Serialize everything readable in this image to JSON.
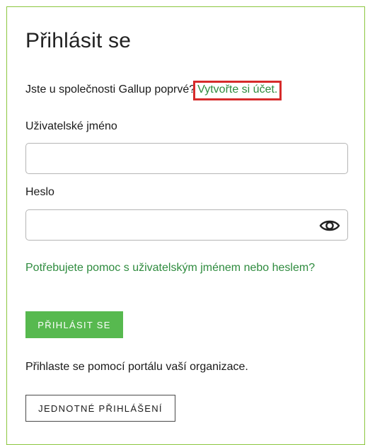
{
  "login": {
    "title": "Přihlásit se",
    "intro_text": "Jste u společnosti Gallup poprvé?",
    "create_account_link": "Vytvořte si účet.",
    "username_label": "Uživatelské jméno",
    "username_value": "",
    "password_label": "Heslo",
    "password_value": "",
    "show_password_icon": "eye-icon",
    "help_link": "Potřebujete pomoc s uživatelským jménem nebo heslem?",
    "login_button": "PŘIHLÁSIT SE",
    "org_portal_text": "Přihlaste se pomocí portálu vaší organizace.",
    "sso_button": "JEDNOTNÉ PŘIHLÁŠENÍ"
  },
  "colors": {
    "card_border": "#8cc63f",
    "link_green": "#2e8b3e",
    "button_green": "#57b94f",
    "highlight_red": "#d62b2b"
  }
}
